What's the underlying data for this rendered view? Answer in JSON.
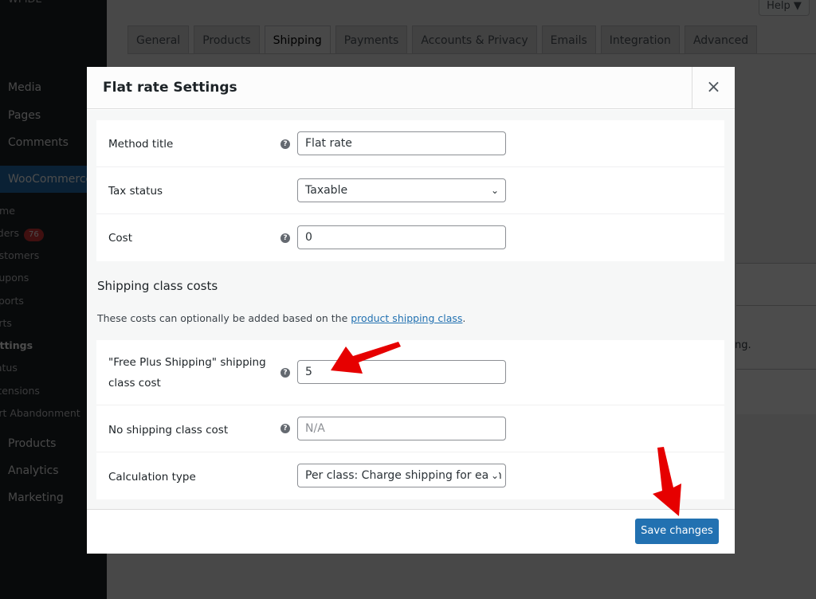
{
  "sidebar": {
    "top_label": "WPIDE",
    "items": [
      {
        "label": "Media"
      },
      {
        "label": "Pages"
      },
      {
        "label": "Comments"
      },
      {
        "label": "WooCommerce"
      }
    ],
    "woo_sub": [
      {
        "label": "Home"
      },
      {
        "label": "Orders",
        "badge": "76"
      },
      {
        "label": "Customers"
      },
      {
        "label": "Coupons"
      },
      {
        "label": "Reports"
      },
      {
        "label": "Carts"
      },
      {
        "label": "Settings"
      },
      {
        "label": "Status"
      },
      {
        "label": "Extensions"
      },
      {
        "label": "Cart Abandonment"
      }
    ],
    "items_after": [
      {
        "label": "Products"
      },
      {
        "label": "Analytics"
      },
      {
        "label": "Marketing"
      }
    ]
  },
  "header": {
    "help_label": "Help ▼"
  },
  "tabs": [
    {
      "label": "General"
    },
    {
      "label": "Products"
    },
    {
      "label": "Shipping",
      "active": true
    },
    {
      "label": "Payments"
    },
    {
      "label": "Accounts & Privacy"
    },
    {
      "label": "Emails"
    },
    {
      "label": "Integration"
    },
    {
      "label": "Advanced"
    }
  ],
  "background_text": "ng.",
  "modal": {
    "title": "Flat rate Settings",
    "close_icon": "×",
    "help_glyph": "?",
    "fields": {
      "method_title": {
        "label": "Method title",
        "value": "Flat rate"
      },
      "tax_status": {
        "label": "Tax status",
        "value": "Taxable"
      },
      "cost": {
        "label": "Cost",
        "value": "0"
      }
    },
    "shipping_class": {
      "title": "Shipping class costs",
      "desc_prefix": "These costs can optionally be added based on the ",
      "desc_link": "product shipping class",
      "desc_suffix": ".",
      "free_plus_label_1": "\"Free Plus Shipping\" shipping",
      "free_plus_label_2": "class cost",
      "free_plus_value": "5",
      "no_class_label": "No shipping class cost",
      "no_class_placeholder": "N/A",
      "calc_label": "Calculation type",
      "calc_value": "Per class: Charge shipping for each sl"
    },
    "save_label": "Save changes"
  },
  "annotations": {
    "arrow_color": "#e60000"
  }
}
